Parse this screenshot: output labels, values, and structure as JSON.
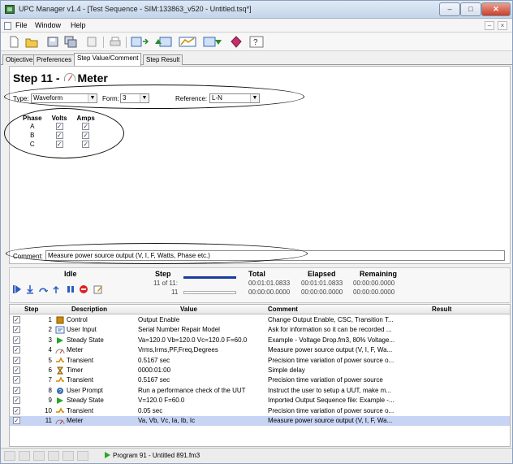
{
  "window": {
    "title": "UPC Manager v1.4 - [Test Sequence - SIM:133863_v520 - Untitled.tsq*]",
    "min": "–",
    "max": "□",
    "close": "✕"
  },
  "menu": {
    "file": "File",
    "window": "Window",
    "help": "Help",
    "mdi_min": "–",
    "mdi_close": "×"
  },
  "tabs": [
    "Objective",
    "Preferences",
    "Step Value/Comment",
    "Step Result"
  ],
  "step": {
    "title_prefix": "Step 11 -",
    "title_name": "Meter",
    "type_label": "Type:",
    "type_value": "Waveform",
    "form_label": "Form:",
    "form_value": "3",
    "reference_label": "Reference:",
    "reference_value": "L-N",
    "phase_headers": [
      "Phase",
      "Volts",
      "Amps"
    ],
    "phases": [
      {
        "name": "A",
        "volts": "✓",
        "amps": "✓"
      },
      {
        "name": "B",
        "volts": "✓",
        "amps": "✓"
      },
      {
        "name": "C",
        "volts": "✓",
        "amps": "✓"
      }
    ],
    "comment_label": "Comment:",
    "comment_value": "Measure power source output (V, I, F, Watts, Phase etc.)"
  },
  "status": {
    "state": "Idle",
    "step_header": "Step",
    "step_line1": "11 of 11:",
    "step_line2": "11",
    "total_header": "Total",
    "total_line1": "00:01:01.0833",
    "total_line2": "00:00:00.0000",
    "elapsed_header": "Elapsed",
    "elapsed_line1": "00:01:01.0833",
    "elapsed_line2": "00:00:00.0000",
    "remaining_header": "Remaining",
    "remaining_line1": "00:00:00.0000",
    "remaining_line2": "00:00:00.0000",
    "step_progress_fraction": 1.0
  },
  "grid": {
    "headers": {
      "step": "Step",
      "description": "Description",
      "value": "Value",
      "comment": "Comment",
      "result": "Result"
    },
    "rows": [
      {
        "num": "1",
        "desc": "Control",
        "value": "Output Enable",
        "comment": "Change Output Enable, CSC, Transition T..."
      },
      {
        "num": "2",
        "desc": "User Input",
        "value": "Serial Number Repair Model",
        "comment": "Ask for information so it can be recorded ..."
      },
      {
        "num": "3",
        "desc": "Steady State",
        "value": "Va=120.0 Vb=120.0 Vc=120.0 F=60.0",
        "comment": "Example - Voltage Drop.fm3, 80% Voltage..."
      },
      {
        "num": "4",
        "desc": "Meter",
        "value": "Vrms,Irms,PF,Freq,Degrees",
        "comment": "Measure power source output (V, I, F, Wa..."
      },
      {
        "num": "5",
        "desc": "Transient",
        "value": "0.5167 sec",
        "comment": "Precision time variation of power source o..."
      },
      {
        "num": "6",
        "desc": "Timer",
        "value": "0000:01:00",
        "comment": "Simple delay"
      },
      {
        "num": "7",
        "desc": "Transient",
        "value": "0.5167 sec",
        "comment": "Precision time variation of power source"
      },
      {
        "num": "8",
        "desc": "User Prompt",
        "value": "Run a performance check of the UUT",
        "comment": "Instruct the user to setup a UUT, make m..."
      },
      {
        "num": "9",
        "desc": "Steady State",
        "value": "V=120.0 F=60.0",
        "comment": "Imported Output Sequence file: Example -..."
      },
      {
        "num": "10",
        "desc": "Transient",
        "value": "0.05 sec",
        "comment": "Precision time variation of power source o..."
      },
      {
        "num": "11",
        "desc": "Meter",
        "value": "Va, Vb, Vc, Ia, Ib, Ic",
        "comment": "Measure power source output (V, I, F, Wa..."
      }
    ],
    "check": "✓"
  },
  "statusbar": {
    "program": "Program 91 - Untitled 891.fm3"
  }
}
